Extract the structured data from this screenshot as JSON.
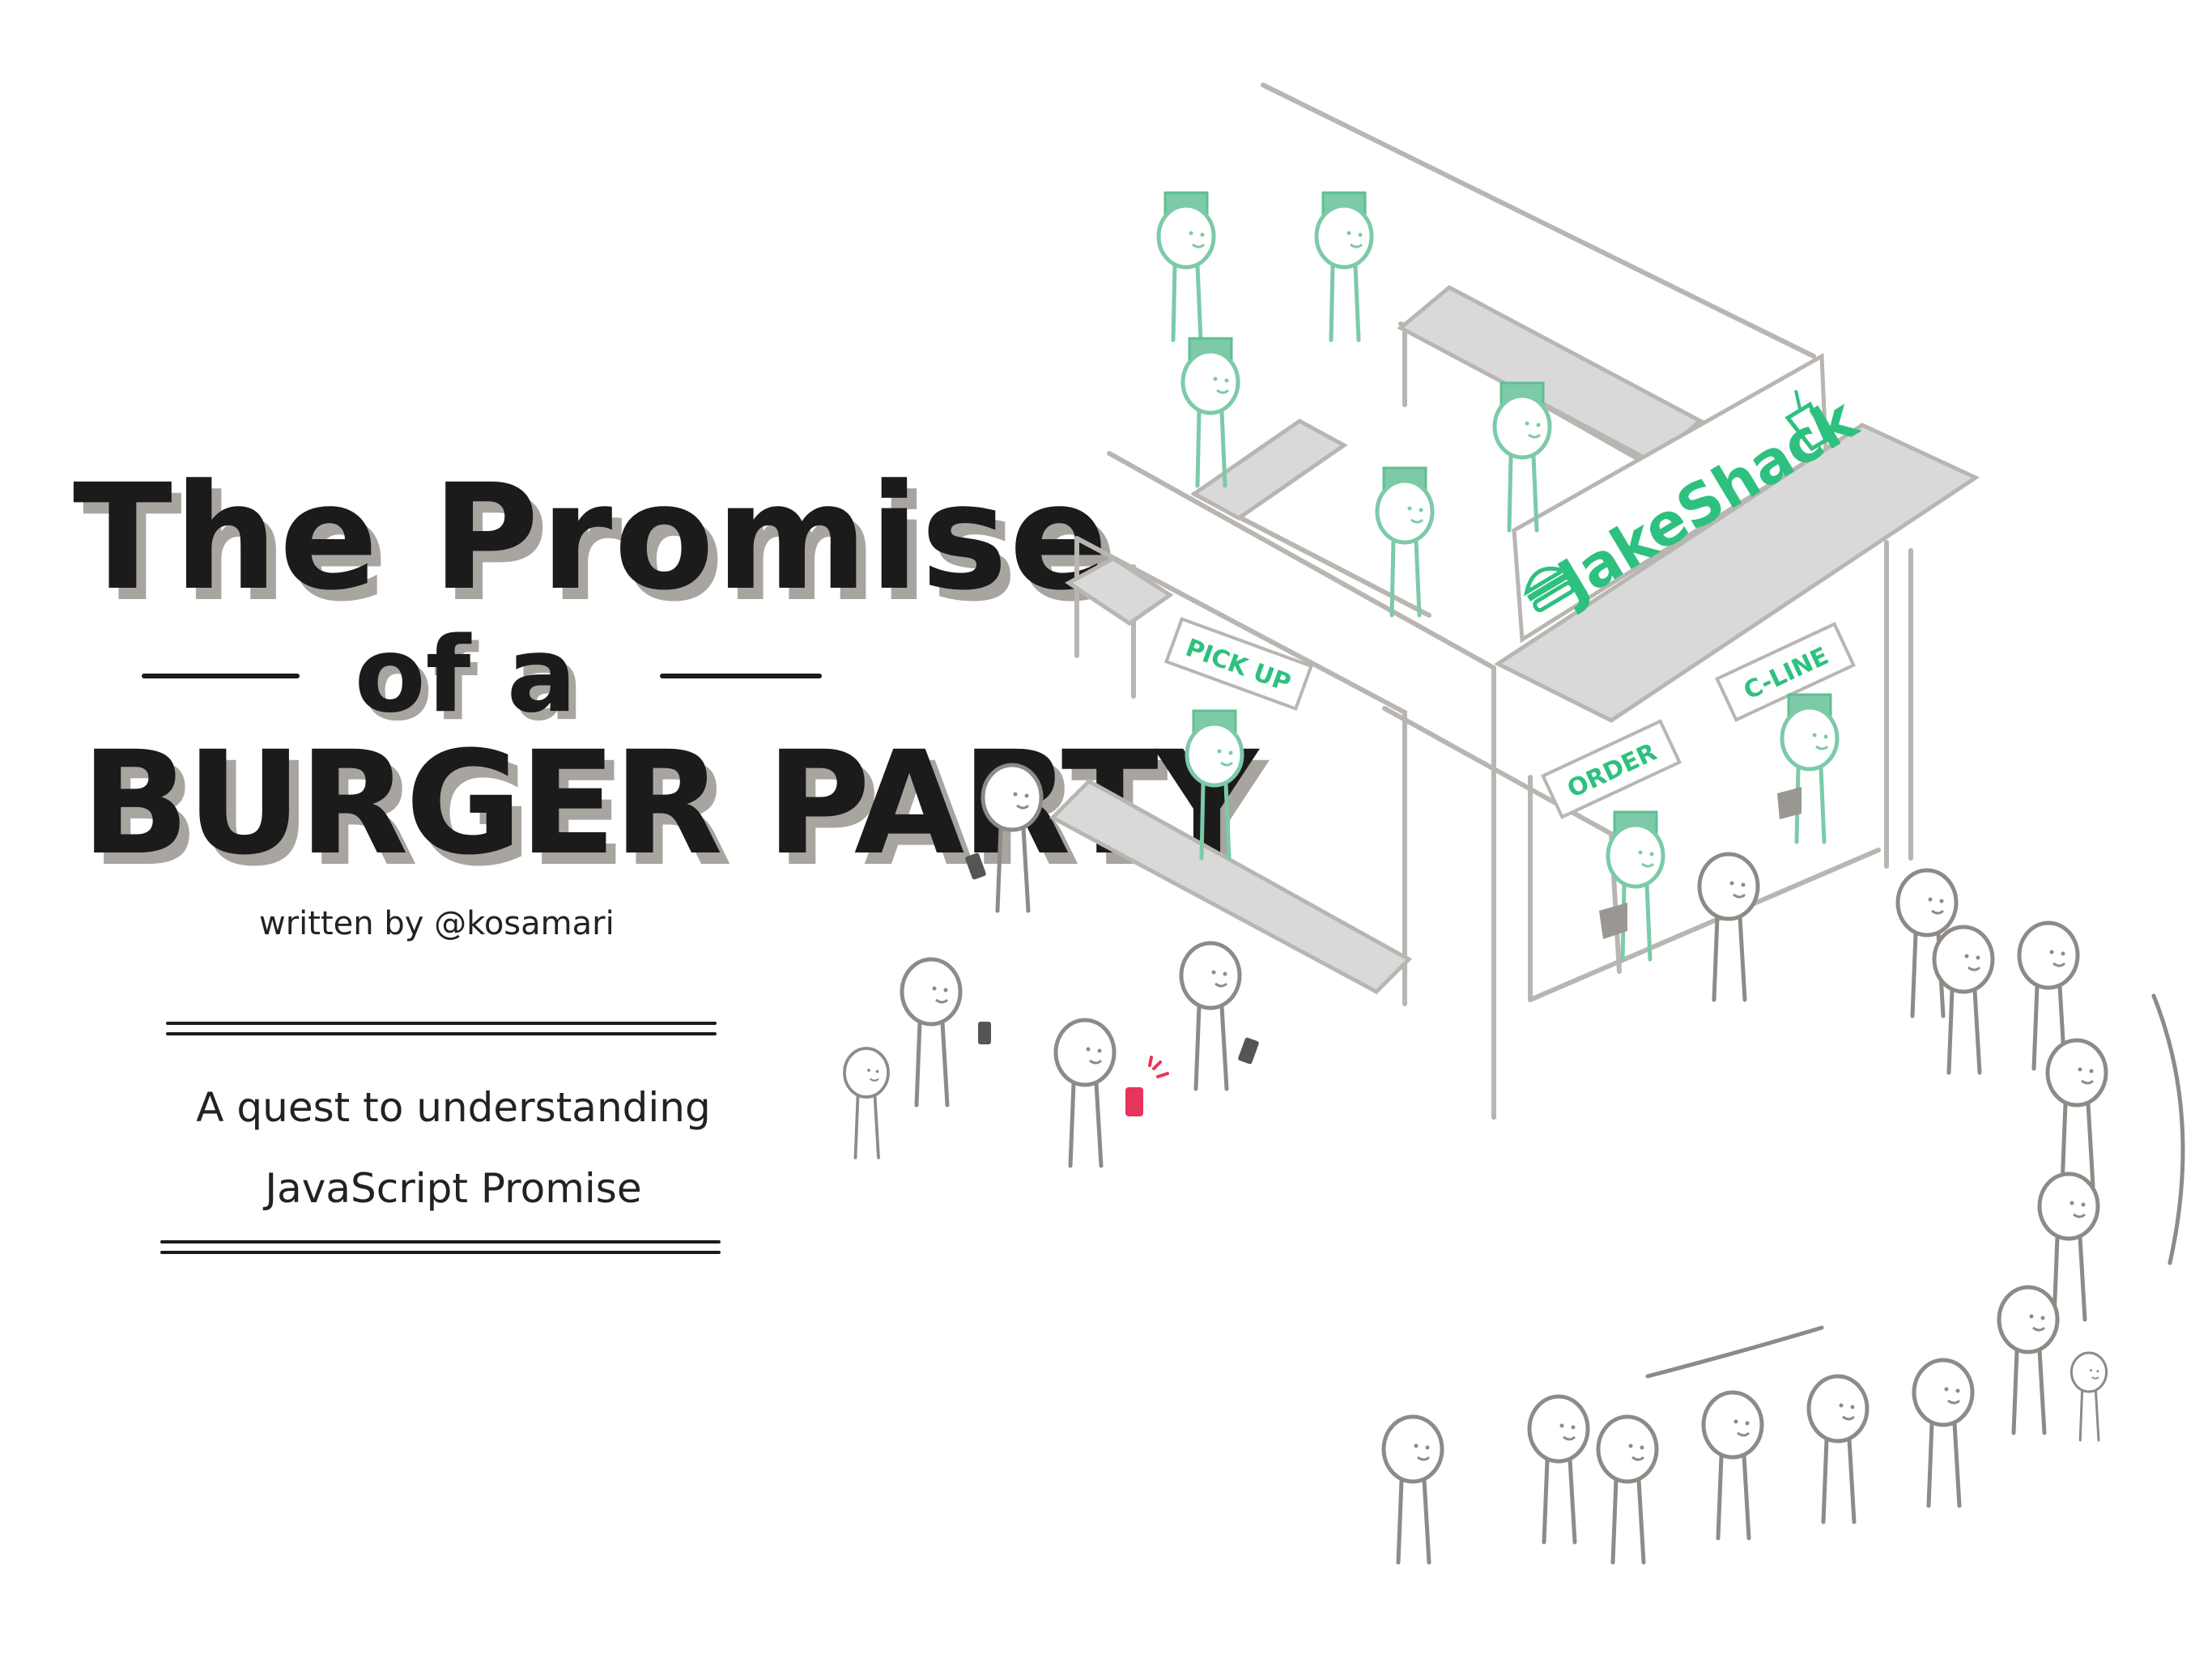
{
  "title": {
    "line1": "The Promise",
    "line2": "of a",
    "line3": "BURGER PARTY"
  },
  "byline": "written by @kosamari",
  "subtitle": {
    "line1": "A quest to understanding",
    "line2": "JavaScript Promise"
  },
  "shop": {
    "name": "JakeShack",
    "signs": {
      "pickup": "PICK UP",
      "order": "ORDER",
      "cline": "C-LINE"
    }
  },
  "colors": {
    "ink": "#1b1b1b",
    "shadow": "#a8a49f",
    "line": "#8e8a86",
    "staff": "#7ccaa8",
    "staff_hat": "#5fbf92",
    "sign_green": "#2ec07f",
    "phone_pink": "#e8335a",
    "awning": "#d9d9d9"
  },
  "icons": [
    "burger-icon",
    "drink-icon",
    "phone-icon"
  ]
}
